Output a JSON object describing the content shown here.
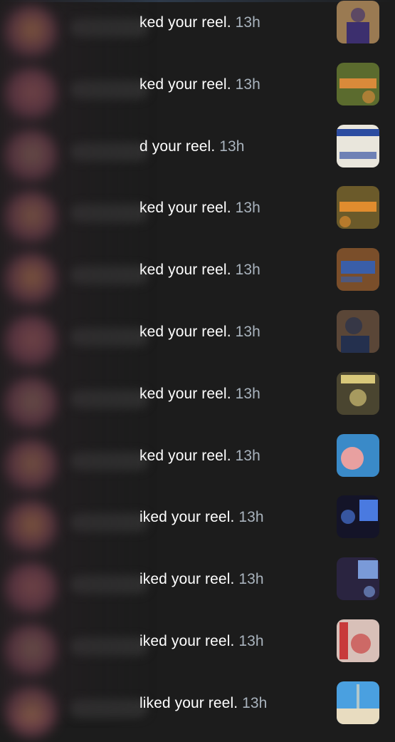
{
  "notifications": [
    {
      "action_text": "ked your reel.",
      "time": "13h",
      "thumb": {
        "bg": "#9a7a52",
        "accent": "#3c2f6e",
        "icon": "reel-thumbnail"
      }
    },
    {
      "action_text": "ked your reel.",
      "time": "13h",
      "thumb": {
        "bg": "#5b6b2e",
        "accent": "#d98a3a",
        "icon": "reel-thumbnail"
      }
    },
    {
      "action_text": "d your reel.",
      "time": "13h",
      "thumb": {
        "bg": "#e9e6dc",
        "accent": "#2c4ca0",
        "icon": "reel-thumbnail"
      }
    },
    {
      "action_text": "ked your reel.",
      "time": "13h",
      "thumb": {
        "bg": "#6b5a2a",
        "accent": "#e08c2e",
        "icon": "reel-thumbnail"
      }
    },
    {
      "action_text": "ked your reel.",
      "time": "13h",
      "thumb": {
        "bg": "#7a4e2a",
        "accent": "#3a5ea8",
        "icon": "reel-thumbnail"
      }
    },
    {
      "action_text": "ked your reel.",
      "time": "13h",
      "thumb": {
        "bg": "#5a4637",
        "accent": "#24304e",
        "icon": "reel-thumbnail"
      }
    },
    {
      "action_text": "ked your reel.",
      "time": "13h",
      "thumb": {
        "bg": "#4a4530",
        "accent": "#d8c87a",
        "icon": "reel-thumbnail"
      }
    },
    {
      "action_text": "ked your reel.",
      "time": "13h",
      "thumb": {
        "bg": "#3a8ac8",
        "accent": "#e8a0a0",
        "icon": "reel-thumbnail"
      }
    },
    {
      "action_text": "iked your reel.",
      "time": "13h",
      "thumb": {
        "bg": "#141428",
        "accent": "#4a7ae0",
        "icon": "reel-thumbnail"
      }
    },
    {
      "action_text": "iked your reel.",
      "time": "13h",
      "thumb": {
        "bg": "#2a2440",
        "accent": "#7a9ad8",
        "icon": "reel-thumbnail"
      }
    },
    {
      "action_text": "iked your reel.",
      "time": "13h",
      "thumb": {
        "bg": "#d8c0b8",
        "accent": "#c83a3a",
        "icon": "reel-thumbnail"
      }
    },
    {
      "action_text": "liked your reel.",
      "time": "13h",
      "thumb": {
        "bg": "#4aa0e0",
        "accent": "#e8dcc0",
        "icon": "reel-thumbnail"
      }
    }
  ]
}
